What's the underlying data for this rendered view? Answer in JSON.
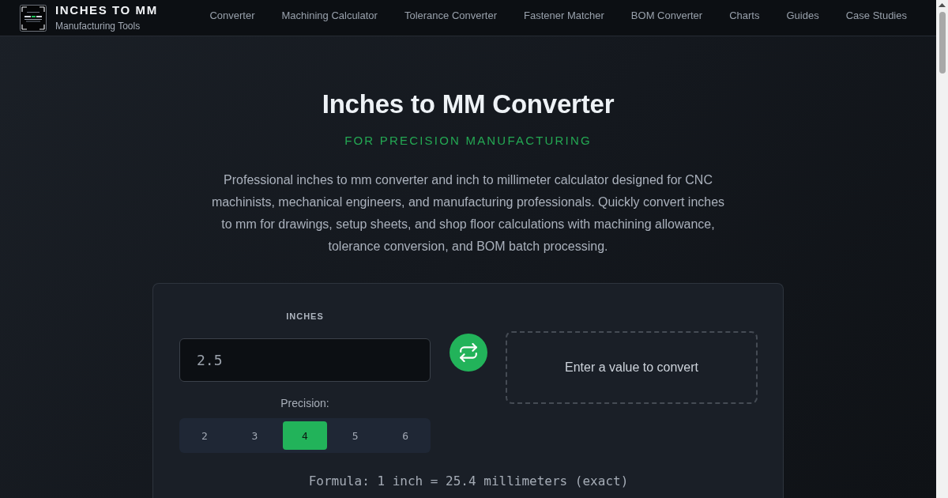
{
  "header": {
    "brand_title": "INCHES TO MM",
    "brand_subtitle": "Manufacturing Tools",
    "nav": [
      "Converter",
      "Machining Calculator",
      "Tolerance Converter",
      "Fastener Matcher",
      "BOM Converter",
      "Charts",
      "Guides",
      "Case Studies"
    ]
  },
  "hero": {
    "title": "Inches to MM Converter",
    "subtitle": "FOR PRECISION MANUFACTURING",
    "description": "Professional inches to mm converter and inch to millimeter calculator designed for CNC machinists, mechanical engineers, and manufacturing professionals. Quickly convert inches to mm for drawings, setup sheets, and shop floor calculations with machining allowance, tolerance conversion, and BOM batch processing."
  },
  "converter": {
    "input_label": "INCHES",
    "input_value": "2.5",
    "precision_label": "Precision:",
    "precision_options": [
      {
        "label": "2",
        "selected": false
      },
      {
        "label": "3",
        "selected": false
      },
      {
        "label": "4",
        "selected": true
      },
      {
        "label": "5",
        "selected": false
      },
      {
        "label": "6",
        "selected": false
      }
    ],
    "result_message": "Enter a value to convert",
    "formula": "Formula: 1 inch = 25.4 millimeters (exact)"
  }
}
